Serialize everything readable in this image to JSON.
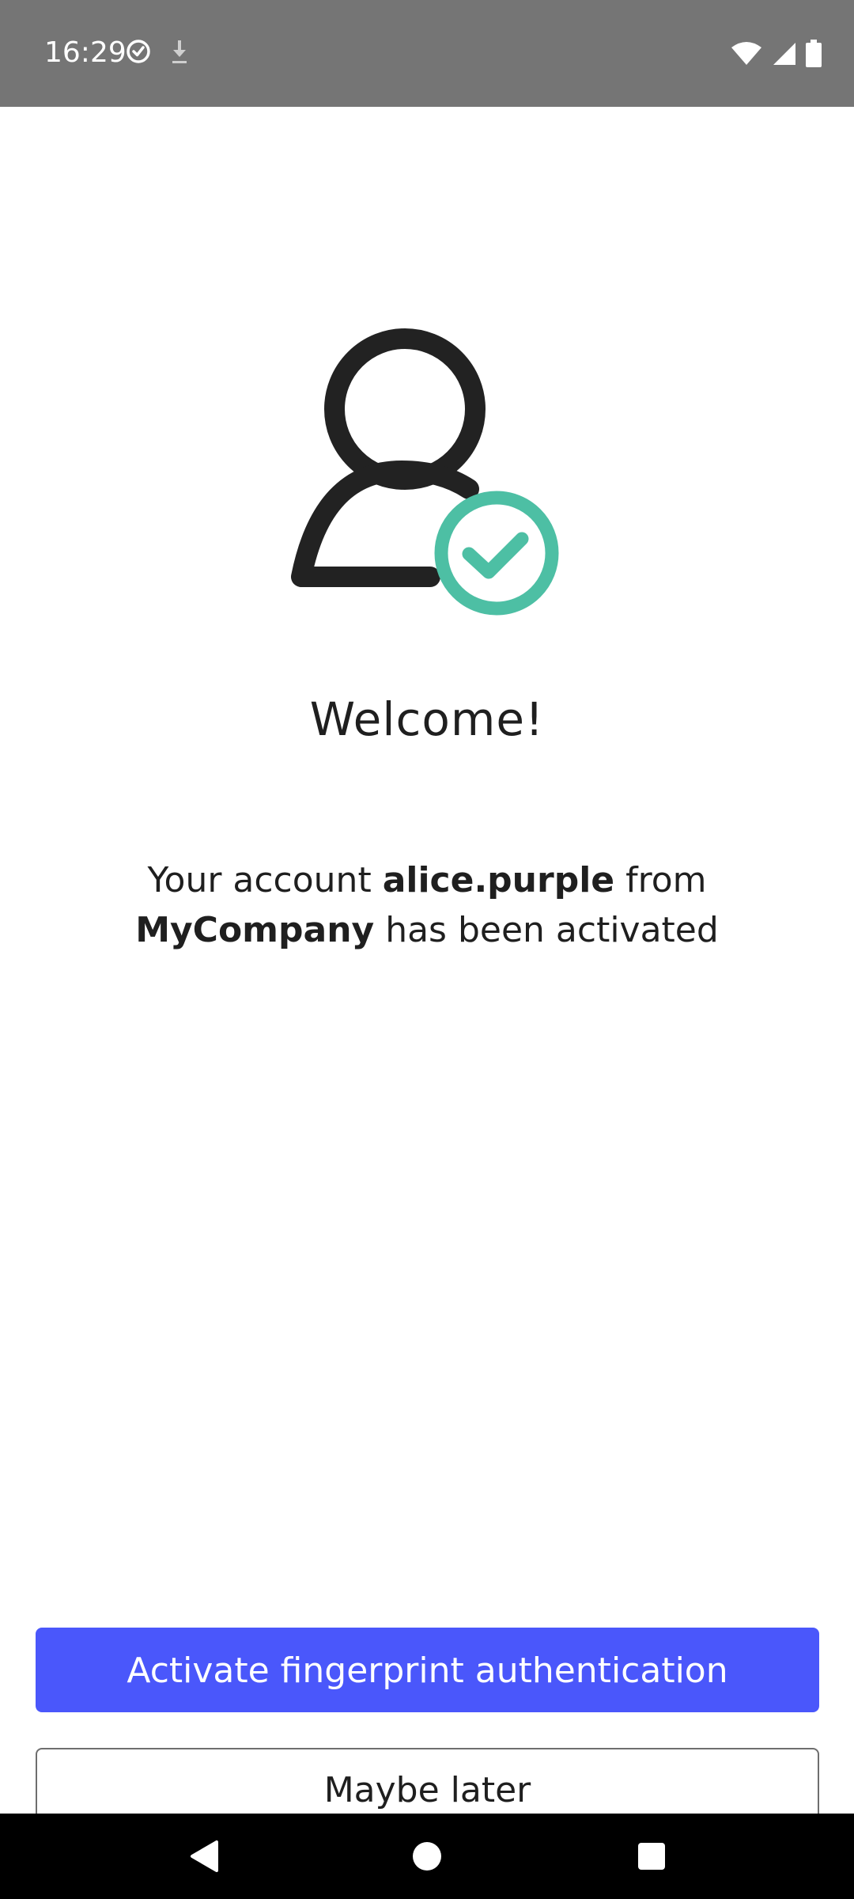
{
  "status_bar": {
    "time": "16:29",
    "icons": [
      "check-circle-icon",
      "download-icon",
      "wifi-icon",
      "signal-icon",
      "battery-icon"
    ]
  },
  "hero": {
    "icon": "user-verified-icon",
    "colors": {
      "figure": "#222222",
      "check": "#4dbfa4"
    }
  },
  "welcome": {
    "title": "Welcome!",
    "message_prefix": "Your account ",
    "username": "alice.purple",
    "message_middle": " from",
    "company": "MyCompany",
    "message_suffix": " has been activated"
  },
  "actions": {
    "primary_label": "Activate fingerprint authentication",
    "primary_color": "#4a57fb",
    "secondary_label": "Maybe later"
  },
  "nav_bar": {
    "icons": [
      "back-icon",
      "home-icon",
      "recents-icon"
    ]
  }
}
